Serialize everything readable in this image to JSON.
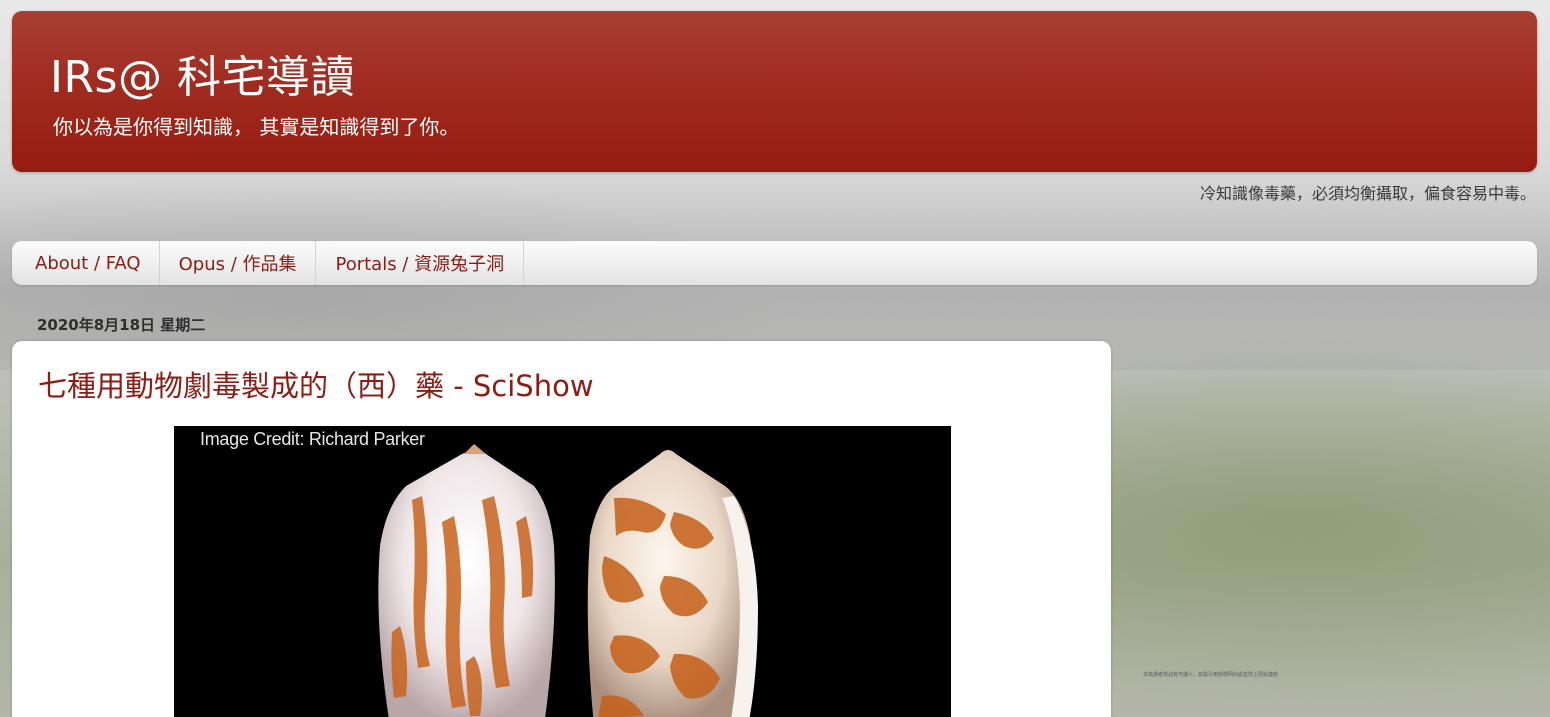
{
  "header": {
    "title": "IRs@ 科宅導讀",
    "description": "你以為是你得到知識， 其實是知識得到了你。"
  },
  "tagline": "冷知識像毒藥，必須均衡攝取，偏食容易中毒。",
  "tabs": [
    {
      "label": "About / FAQ"
    },
    {
      "label": "Opus / 作品集"
    },
    {
      "label": "Portals / 資源兔子洞"
    }
  ],
  "post": {
    "date": "2020年8月18日 星期二",
    "title": "七種用動物劇毒製成的（西）藥 - SciShow",
    "image_credit": "Image Credit: Richard Parker",
    "image_subject": "cone-snail-shells"
  },
  "sidebar": {
    "note": "本篇譯者標註有可讀人，如需引用請標明出處並附上原始連結"
  },
  "colors": {
    "header_red": "#a02c20",
    "link_red": "#8c1d14"
  }
}
